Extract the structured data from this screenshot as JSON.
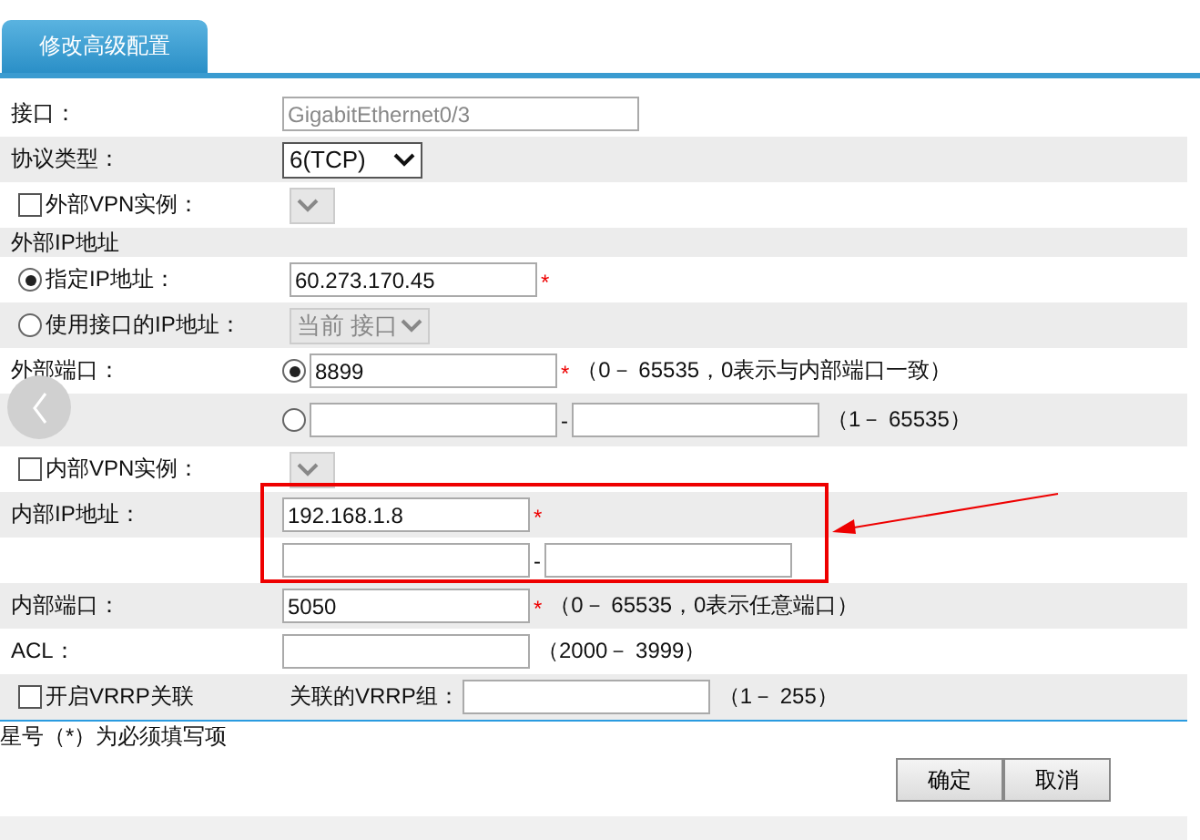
{
  "tab": {
    "label": "修改高级配置",
    "selected": true
  },
  "rows": [
    {
      "kind": "text",
      "label": "接口：",
      "value": "GigabitEthernet0/3",
      "disabled": true
    },
    {
      "kind": "select",
      "label": "协议类型：",
      "value": "6(TCP)"
    },
    {
      "kind": "check_select",
      "label": "外部VPN实例：",
      "checked": false
    },
    {
      "kind": "section",
      "label": "外部IP地址"
    },
    {
      "kind": "radio_input",
      "label": "指定IP地址：",
      "selected": true,
      "value": "60.273.170.45",
      "mark": "*"
    },
    {
      "kind": "radio_select",
      "label": "使用接口的IP地址：",
      "selected": false,
      "value": "当前 接口"
    },
    {
      "kind": "port",
      "label": "外部端口：",
      "selected": true,
      "value": "8899",
      "mark": "*",
      "hint": "（0－ 65535，0表示与内部端口一致）"
    },
    {
      "kind": "port_range",
      "selected": false,
      "separator": "-",
      "hint": "（1－ 65535）"
    },
    {
      "kind": "check_select",
      "label": "内部VPN实例：",
      "checked": false
    },
    {
      "kind": "input",
      "label": "内部IP地址：",
      "value": "192.168.1.8",
      "mark": "*"
    },
    {
      "kind": "range",
      "separator": "-"
    },
    {
      "kind": "input",
      "label": "内部端口：",
      "value": "5050",
      "mark": "*",
      "hint": "（0－ 65535，0表示任意端口）"
    },
    {
      "kind": "input",
      "label": "ACL：",
      "value": "",
      "hint": "（2000－ 3999）"
    },
    {
      "kind": "vrrp",
      "label": "开启VRRP关联",
      "checked": false,
      "group_label": "关联的VRRP组：",
      "hint": "（1－ 255）"
    }
  ],
  "footnote": "星号（*）为必须填写项",
  "buttons": [
    "确定",
    "取消"
  ]
}
